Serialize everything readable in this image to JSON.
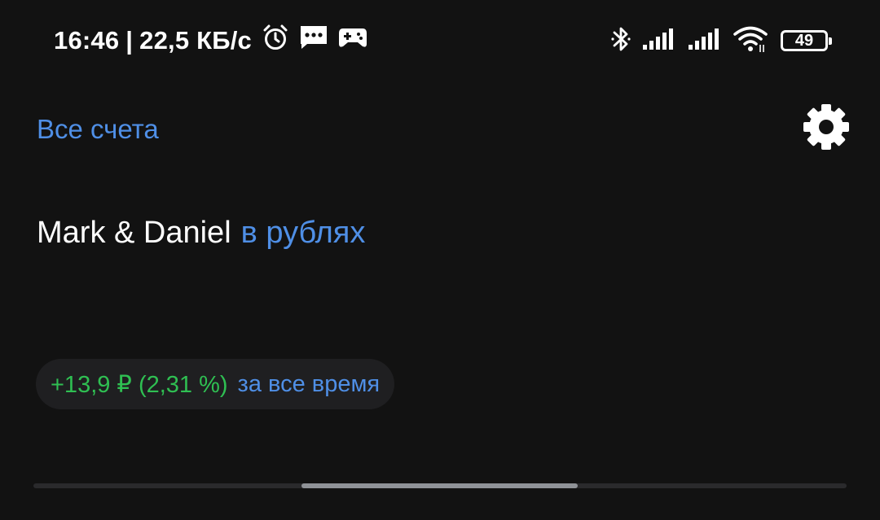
{
  "status_bar": {
    "time": "16:46",
    "separator": "|",
    "net_speed": "22,5 КБ/с",
    "battery_level": "49",
    "left_icons": [
      "alarm-icon",
      "message-icon",
      "gamepad-icon"
    ],
    "right_icons": [
      "bluetooth-icon",
      "signal-icon",
      "signal-icon",
      "wifi-icon",
      "battery-icon"
    ]
  },
  "header": {
    "all_accounts_label": "Все счета",
    "settings_icon": "gear-icon"
  },
  "account": {
    "name": "Mark & Daniel",
    "currency_label": "в рублях"
  },
  "profit": {
    "value": "+13,9 ₽ (2,31 %)",
    "period_label": "за все время"
  },
  "scroll_indicator": {
    "position_fraction": 0.33,
    "visible_fraction": 0.34
  },
  "colors": {
    "background": "#121212",
    "accent_blue": "#4f8fe6",
    "profit_green": "#2fbf52",
    "chip_background": "#1f1f21"
  }
}
